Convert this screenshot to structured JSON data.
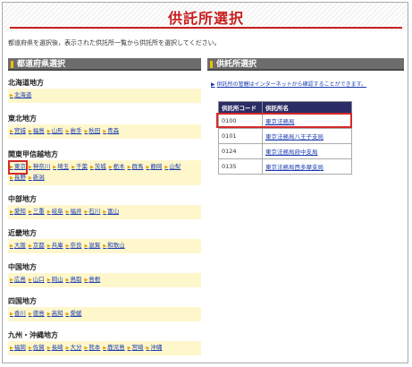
{
  "page": {
    "title": "供託所選択",
    "instruction": "都道府県を選択後，表示された供託所一覧から供託所を選択してください。"
  },
  "left": {
    "header": "都道府県選択",
    "regions": [
      {
        "name": "北海道地方",
        "prefs": [
          "北海道"
        ]
      },
      {
        "name": "東北地方",
        "prefs": [
          "宮城",
          "福島",
          "山形",
          "岩手",
          "秋田",
          "青森"
        ]
      },
      {
        "name": "関東甲信越地方",
        "prefs": [
          "東京",
          "神奈川",
          "埼玉",
          "千葉",
          "茨城",
          "栃木",
          "群馬",
          "静岡",
          "山梨",
          "長野",
          "新潟"
        ]
      },
      {
        "name": "中部地方",
        "prefs": [
          "愛知",
          "三重",
          "岐阜",
          "福井",
          "石川",
          "富山"
        ]
      },
      {
        "name": "近畿地方",
        "prefs": [
          "大阪",
          "京都",
          "兵庫",
          "奈良",
          "滋賀",
          "和歌山"
        ]
      },
      {
        "name": "中国地方",
        "prefs": [
          "広島",
          "山口",
          "岡山",
          "鳥取",
          "島根"
        ]
      },
      {
        "name": "四国地方",
        "prefs": [
          "香川",
          "徳島",
          "高知",
          "愛媛"
        ]
      },
      {
        "name": "九州・沖縄地方",
        "prefs": [
          "福岡",
          "佐賀",
          "長崎",
          "大分",
          "熊本",
          "鹿児島",
          "宮崎",
          "沖縄"
        ]
      }
    ],
    "selected_pref": "東京"
  },
  "right": {
    "header": "供託所選択",
    "link_text": "供託所の管轄はインターネットから確認することができます。",
    "table_headers": [
      "供託所コード",
      "供託所名"
    ],
    "rows": [
      {
        "code": "0100",
        "name": "東京法務局"
      },
      {
        "code": "0101",
        "name": "東京法務局八王子支局"
      },
      {
        "code": "0124",
        "name": "東京法務局府中支局"
      },
      {
        "code": "0135",
        "name": "東京法務局西多摩支局"
      }
    ],
    "selected_code": "0100"
  },
  "colors": {
    "accent_red": "#c81e1e",
    "header_gray": "#6d6d6d",
    "pref_bg": "#fff7cc",
    "table_header": "#2b2b66",
    "link_blue": "#1a3db0"
  }
}
